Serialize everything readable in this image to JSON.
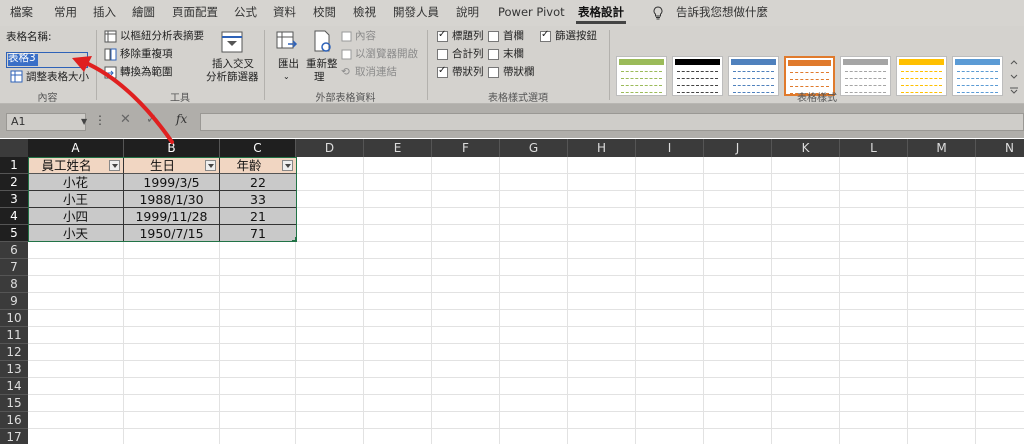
{
  "tabs": [
    "檔案",
    "常用",
    "插入",
    "繪圖",
    "頁面配置",
    "公式",
    "資料",
    "校閱",
    "檢視",
    "開發人員",
    "說明",
    "Power Pivot",
    "表格設計"
  ],
  "active_tab": "表格設計",
  "tell_me": "告訴我您想做什麼",
  "properties": {
    "label": "表格名稱:",
    "table_name": "表格3",
    "resize_label": "調整表格大小",
    "group_title": "內容"
  },
  "tools": {
    "pivot": "以樞紐分析表摘要",
    "remove_dup": "移除重複項",
    "convert": "轉換為範圍",
    "slicer_line1": "插入交叉",
    "slicer_line2": "分析篩選器",
    "group_title": "工具"
  },
  "external": {
    "export_label": "匯出",
    "refresh_line1": "重新整",
    "refresh_line2": "理",
    "properties_label": "內容",
    "open_browser": "以瀏覽器開啟",
    "unlink": "取消連結",
    "group_title": "外部表格資料"
  },
  "style_options": {
    "header_row": "標題列",
    "first_col": "首欄",
    "filter_btn": "篩選按鈕",
    "total_row": "合計列",
    "last_col": "末欄",
    "banded_rows": "帶狀列",
    "banded_cols": "帶狀欄",
    "group_title": "表格樣式選項",
    "checked": {
      "header_row": true,
      "first_col": false,
      "filter_btn": true,
      "total_row": false,
      "last_col": false,
      "banded_rows": true,
      "banded_cols": false
    }
  },
  "table_styles": {
    "group_title": "表格樣式",
    "swatch_colors": [
      "#9bbb59",
      "#000000",
      "#4f81bd",
      "#e07a2c",
      "#a5a5a5",
      "#ffc000",
      "#5b9bd5"
    ],
    "selected_index": 3
  },
  "formula_bar": {
    "name_box": "A1",
    "fx": "fx"
  },
  "columns": [
    "A",
    "B",
    "C",
    "D",
    "E",
    "F",
    "G",
    "H",
    "I",
    "J",
    "K",
    "L",
    "M",
    "N"
  ],
  "rows": [
    "1",
    "2",
    "3",
    "4",
    "5",
    "6",
    "7",
    "8",
    "9",
    "10",
    "11",
    "12",
    "13",
    "14",
    "15",
    "16",
    "17"
  ],
  "table": {
    "headers": [
      "員工姓名",
      "生日",
      "年齡"
    ],
    "data": [
      [
        "小花",
        "1999/3/5",
        "22"
      ],
      [
        "小王",
        "1988/1/30",
        "33"
      ],
      [
        "小四",
        "1999/11/28",
        "21"
      ],
      [
        "小天",
        "1950/7/15",
        "71"
      ]
    ]
  },
  "colors": {
    "accent": "#217346",
    "header_fill": "#f1d6c2",
    "arrow": "#e02020"
  }
}
